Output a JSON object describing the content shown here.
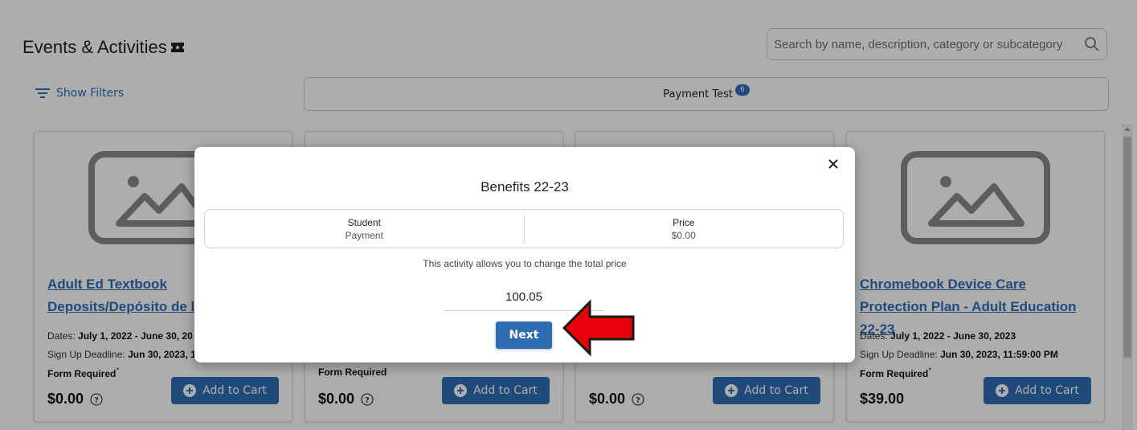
{
  "header": {
    "title": "Events & Activities",
    "search_placeholder": "Search by name, description, category or subcategory"
  },
  "filters": {
    "label": "Show Filters"
  },
  "tabs": [
    {
      "label": "Payment Test",
      "badge": "6"
    }
  ],
  "cards": [
    {
      "title": "Adult Ed Textbook Deposits/Depósito de li",
      "dates_label": "Dates: ",
      "dates": "July 1, 2022 - June 30, 20",
      "deadline_label": "Sign Up Deadline: ",
      "deadline": "Jun 30, 2023, 1",
      "form": "Form Required",
      "form_mark": "*",
      "price": "$0.00",
      "cart_label": "Add to Cart"
    },
    {
      "title": "",
      "dates_label": "",
      "dates": "",
      "deadline_label": "",
      "deadline": "",
      "form": "Form Required",
      "form_mark": "",
      "price": "$0.00",
      "cart_label": "Add to Cart"
    },
    {
      "title": "",
      "dates_label": "",
      "dates": "",
      "deadline_label": "",
      "deadline": "",
      "form": "",
      "form_mark": "",
      "price": "$0.00",
      "cart_label": "Add to Cart"
    },
    {
      "title": "Chromebook Device Care Protection Plan - Adult Education 22-23",
      "dates_label": "Dates: ",
      "dates": "July 1, 2022 - June 30, 2023",
      "deadline_label": "Sign Up Deadline: ",
      "deadline": "Jun 30, 2023, 11:59:00 PM",
      "form": "Form Required",
      "form_mark": "*",
      "price": "$39.00",
      "cart_label": "Add to Cart"
    }
  ],
  "modal": {
    "title": "Benefits 22-23",
    "col1_label": "Student",
    "col1_value": "Payment",
    "col2_label": "Price",
    "col2_value": "$0.00",
    "note": "This activity allows you to change the total price",
    "price_value": "100.05",
    "next_label": "Next"
  },
  "colors": {
    "accent": "#2f6db3",
    "annotation_arrow": "#e8000b"
  }
}
